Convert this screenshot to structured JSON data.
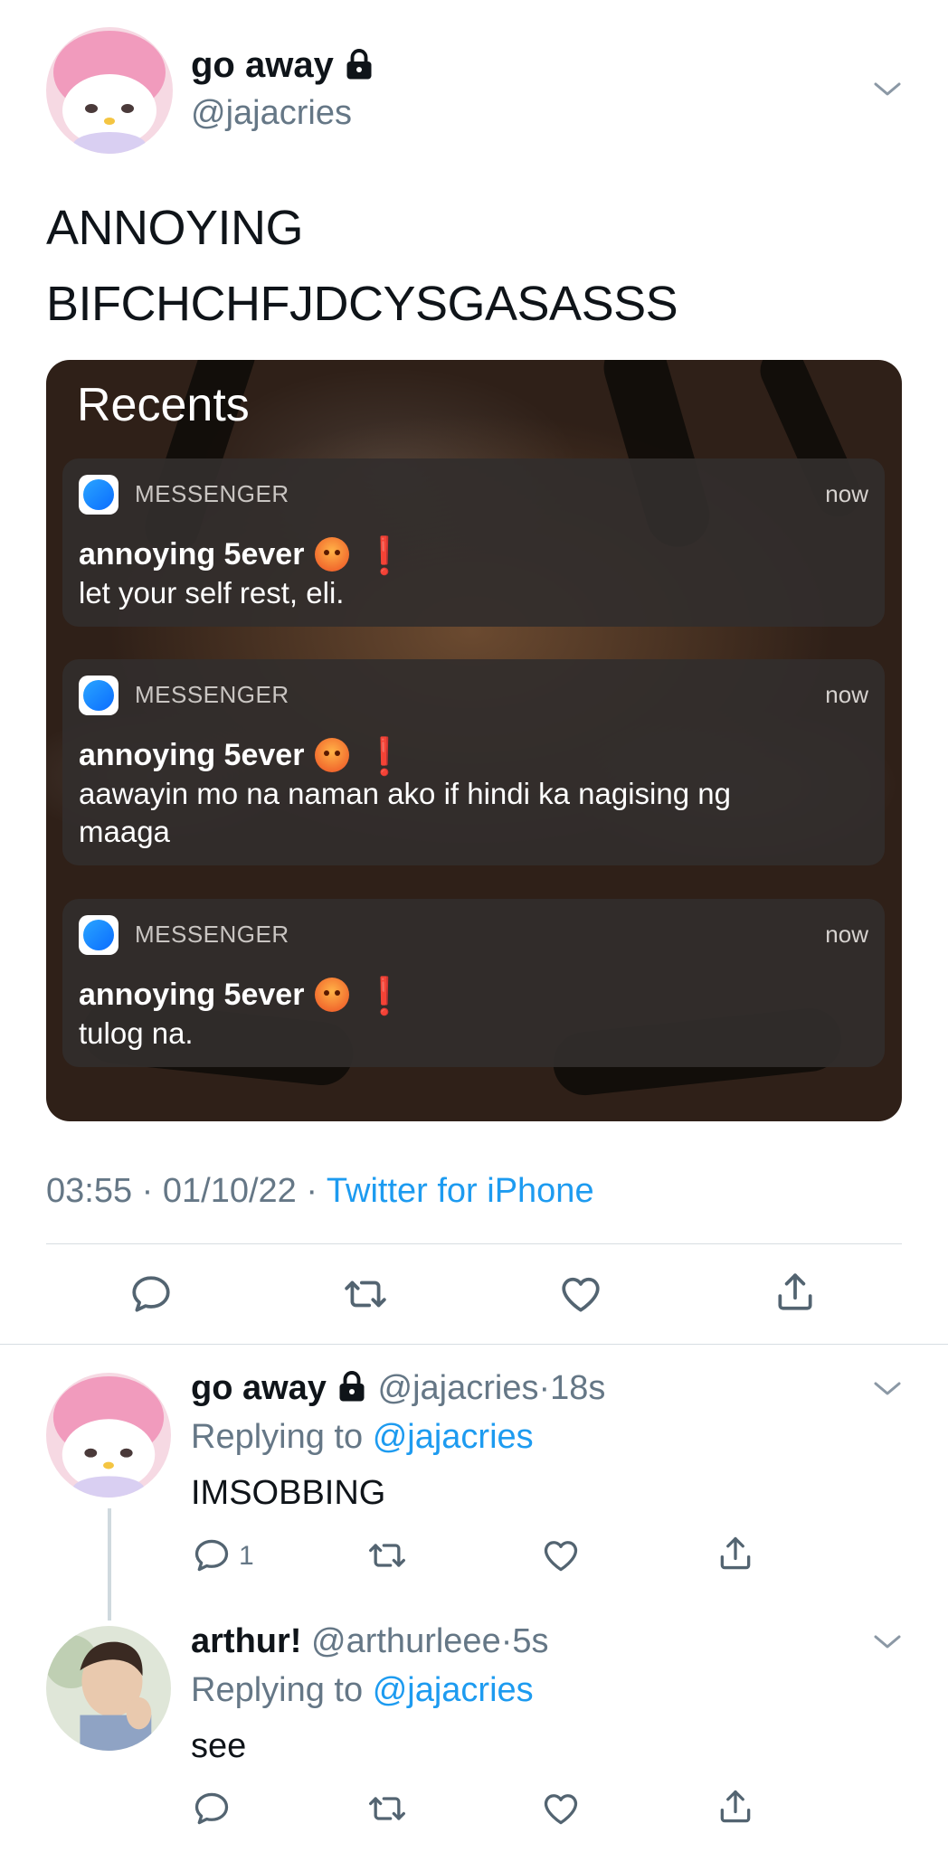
{
  "main_tweet": {
    "display_name": "go away",
    "handle": "@jajacries",
    "text_line1": "ANNOYING",
    "text_line2": "BIFCHCHFJDCYSGASASSS",
    "time": "03:55",
    "date": "01/10/22",
    "source": "Twitter for iPhone",
    "separator": "·"
  },
  "screenshot": {
    "title": "Recents",
    "notifications": [
      {
        "app": "MESSENGER",
        "time": "now",
        "title": "annoying 5ever",
        "emoji": "angry-face",
        "mark": "❗",
        "body": "let your self rest, eli."
      },
      {
        "app": "MESSENGER",
        "time": "now",
        "title": "annoying 5ever",
        "emoji": "angry-face",
        "mark": "❗",
        "body": "aawayin mo na naman ako if hindi ka nagising ng maaga"
      },
      {
        "app": "MESSENGER",
        "time": "now",
        "title": "annoying 5ever",
        "emoji": "angry-face",
        "mark": "❗",
        "body": "tulog na."
      }
    ]
  },
  "replies": [
    {
      "display_name": "go away",
      "handle": "@jajacries",
      "dot": "·",
      "age": "18s",
      "replying_prefix": "Replying to",
      "replying_to": "@jajacries",
      "text": "IMSOBBING",
      "reply_count": "1"
    },
    {
      "display_name": "arthur!",
      "handle": "@arthurleee",
      "dot": "·",
      "age": "5s",
      "replying_prefix": "Replying to",
      "replying_to": "@jajacries",
      "text": "see"
    }
  ],
  "colors": {
    "link": "#1d9bf0",
    "secondary": "#657786",
    "icon": "#536471"
  },
  "icons": [
    "lock-icon",
    "chevron-down-icon",
    "reply-icon",
    "retweet-icon",
    "like-icon",
    "share-icon",
    "messenger-icon"
  ]
}
